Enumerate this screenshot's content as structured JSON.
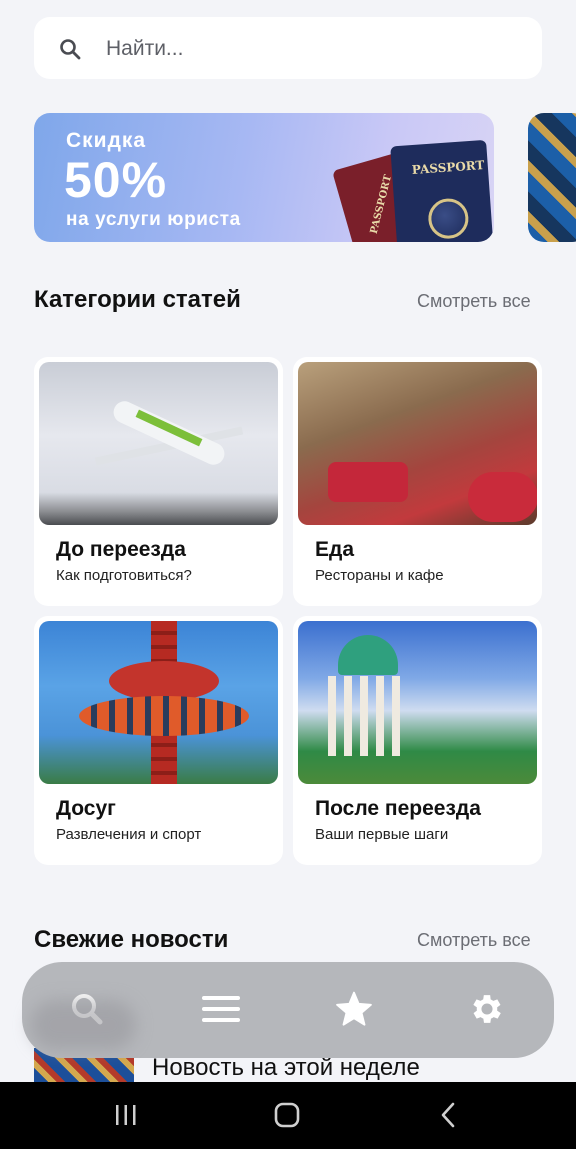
{
  "search": {
    "placeholder": "Найти...",
    "icon": "search-icon"
  },
  "banner": {
    "line1": "Скидка",
    "line2": "50%",
    "line3": "на услуги юриста",
    "passport_text": "PASSPORT"
  },
  "categories_section": {
    "title": "Категории статей",
    "see_all": "Смотреть все",
    "cards": [
      {
        "title": "До переезда",
        "subtitle": "Как подготовиться?"
      },
      {
        "title": "Еда",
        "subtitle": "Рестораны и кафе"
      },
      {
        "title": "Досуг",
        "subtitle": "Развлечения и спорт"
      },
      {
        "title": "После переезда",
        "subtitle": "Ваши первые шаги"
      }
    ]
  },
  "news_section": {
    "title": "Свежие новости",
    "see_all": "Смотреть все",
    "items": [
      {
        "title": "Новость на этой неделе"
      }
    ]
  },
  "bottom_nav": {
    "items": [
      {
        "icon": "search-icon"
      },
      {
        "icon": "menu-icon"
      },
      {
        "icon": "star-icon"
      },
      {
        "icon": "gear-icon"
      }
    ],
    "color": "#ffffff",
    "background": "#b5b7bb"
  },
  "system_nav": {
    "items": [
      "recents-icon",
      "home-icon",
      "back-icon"
    ]
  }
}
